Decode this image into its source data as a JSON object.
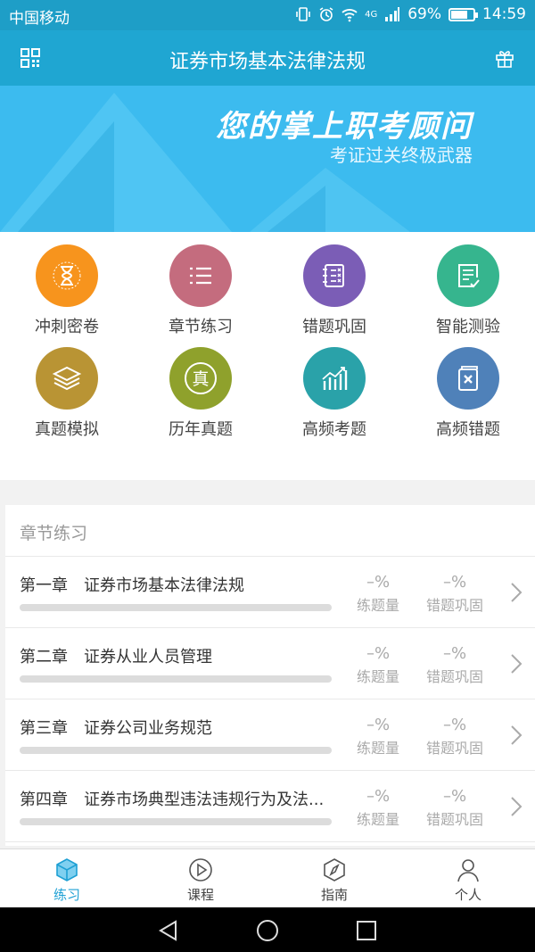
{
  "status_bar": {
    "carrier": "中国移动",
    "network": "4G",
    "battery": "69%",
    "battery_level": 0.69,
    "time": "14:59"
  },
  "header": {
    "title": "证券市场基本法律法规",
    "left_icon": "grid-icon",
    "right_icon": "gift-icon"
  },
  "banner": {
    "slogan": "您的掌上职考顾问",
    "subslogan": "考证过关终极武器"
  },
  "grid": [
    {
      "label": "冲刺密卷",
      "color": "#f7941d",
      "icon": "hourglass-icon"
    },
    {
      "label": "章节练习",
      "color": "#c46c7e",
      "icon": "list-icon"
    },
    {
      "label": "错题巩固",
      "color": "#7b5db6",
      "icon": "wrong-notes-icon"
    },
    {
      "label": "智能测验",
      "color": "#36b58e",
      "icon": "check-document-icon"
    },
    {
      "label": "真题模拟",
      "color": "#b99434",
      "icon": "layers-icon"
    },
    {
      "label": "历年真题",
      "color": "#8fa12c",
      "icon": "zhen-badge-icon"
    },
    {
      "label": "高频考题",
      "color": "#2aa2a9",
      "icon": "bar-chart-icon"
    },
    {
      "label": "高频错题",
      "color": "#4f81b9",
      "icon": "wrong-book-icon"
    }
  ],
  "chapters": {
    "title": "章节练习",
    "rows": [
      {
        "name": "第一章　证券市场基本法律法规",
        "practice_value": "–%",
        "practice_label": "练题量",
        "wrong_value": "–%",
        "wrong_label": "错题巩固"
      },
      {
        "name": "第二章　证券从业人员管理",
        "practice_value": "–%",
        "practice_label": "练题量",
        "wrong_value": "–%",
        "wrong_label": "错题巩固"
      },
      {
        "name": "第三章　证券公司业务规范",
        "practice_value": "–%",
        "practice_label": "练题量",
        "wrong_value": "–%",
        "wrong_label": "错题巩固"
      },
      {
        "name": "第四章　证券市场典型违法违规行为及法...",
        "practice_value": "–%",
        "practice_label": "练题量",
        "wrong_value": "–%",
        "wrong_label": "错题巩固"
      }
    ]
  },
  "tabs": [
    {
      "label": "练习",
      "icon": "cube-icon",
      "active": true
    },
    {
      "label": "课程",
      "icon": "play-icon",
      "active": false
    },
    {
      "label": "指南",
      "icon": "compass-icon",
      "active": false
    },
    {
      "label": "个人",
      "icon": "person-icon",
      "active": false
    }
  ],
  "colors": {
    "primary": "#1fa6d2",
    "banner": "#3cbbef",
    "active_tab": "#1ea0d4"
  }
}
